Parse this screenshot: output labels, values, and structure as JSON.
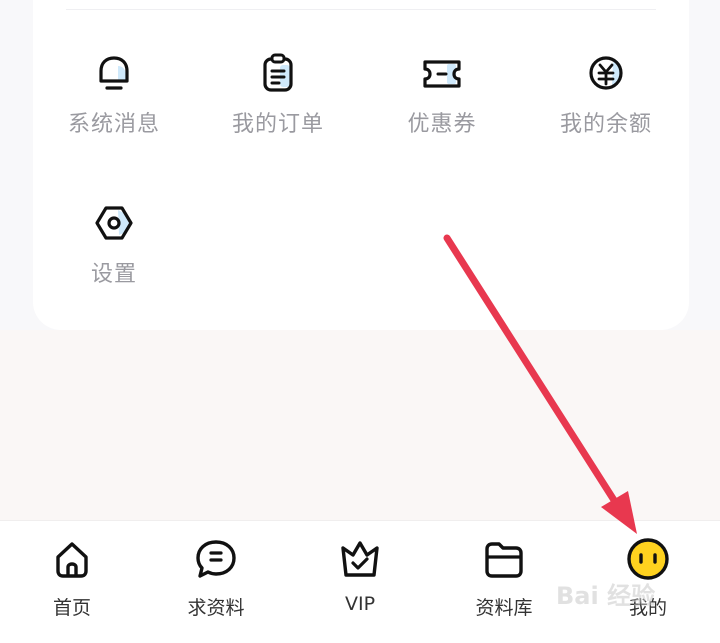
{
  "menu": [
    {
      "label": "系统消息",
      "icon": "bell-icon"
    },
    {
      "label": "我的订单",
      "icon": "clipboard-icon"
    },
    {
      "label": "优惠券",
      "icon": "ticket-icon"
    },
    {
      "label": "我的余额",
      "icon": "yen-coin-icon"
    },
    {
      "label": "设置",
      "icon": "settings-hexagon-icon"
    }
  ],
  "tabs": [
    {
      "label": "首页",
      "icon": "home-icon"
    },
    {
      "label": "求资料",
      "icon": "chat-bubble-icon"
    },
    {
      "label": "VIP",
      "icon": "crown-icon"
    },
    {
      "label": "资料库",
      "icon": "folder-icon"
    },
    {
      "label": "我的",
      "icon": "smiley-face-icon",
      "active": true
    }
  ],
  "colors": {
    "accent": "#ffd21f",
    "icon_fill": "#cfe9fb",
    "annotation_arrow": "#e8384f"
  },
  "watermark": "Bai 经验"
}
